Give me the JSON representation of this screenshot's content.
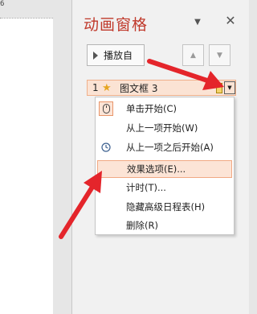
{
  "slide": {
    "ruler_text": "6"
  },
  "pane": {
    "title": "动画窗格",
    "dropdown_glyph": "▼",
    "close_glyph": "✕",
    "play_button_label": "播放自",
    "move_up_glyph": "▲",
    "move_down_glyph": "▼"
  },
  "animation_item": {
    "number": "1",
    "effect_glyph": "★",
    "name": "图文框 3",
    "dropdown_glyph": "▼"
  },
  "context_menu": {
    "items": [
      {
        "label": "单击开始(C)",
        "icon": "mouse-icon",
        "checked": true
      },
      {
        "label": "从上一项开始(W)",
        "icon": "",
        "checked": false
      },
      {
        "label": "从上一项之后开始(A)",
        "icon": "clock-icon",
        "checked": false
      },
      {
        "label": "效果选项(E)...",
        "icon": "",
        "checked": false,
        "highlighted": true
      },
      {
        "label": "计时(T)...",
        "icon": "",
        "checked": false
      },
      {
        "label": "隐藏高级日程表(H)",
        "icon": "",
        "checked": false
      },
      {
        "label": "删除(R)",
        "icon": "",
        "checked": false
      }
    ]
  },
  "colors": {
    "pane_title": "#c0392b",
    "selected_item_bg": "#fbe3d4",
    "annotation_arrow": "#e4252b"
  }
}
